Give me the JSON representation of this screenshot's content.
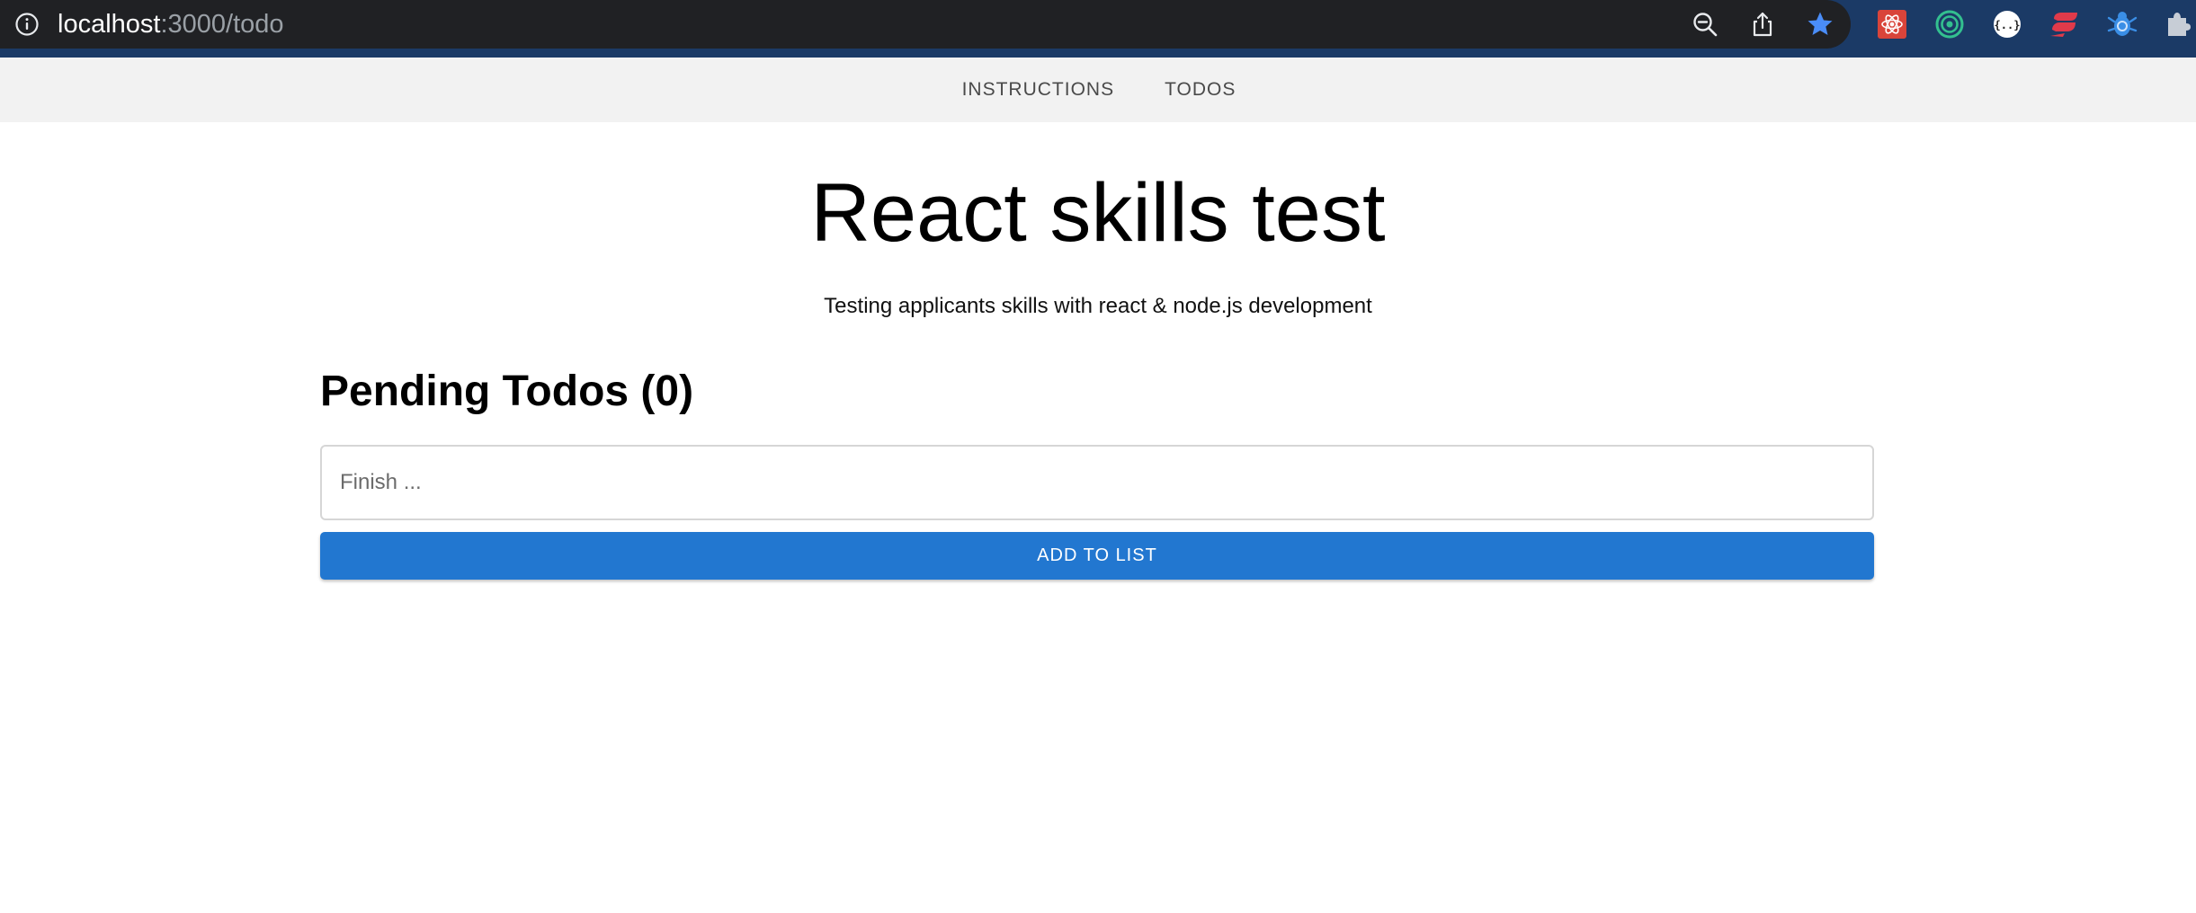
{
  "browser": {
    "url_host": "localhost",
    "url_path": ":3000/todo",
    "icons": [
      "info-icon",
      "zoom-out-icon",
      "share-icon",
      "bookmark-star-icon",
      "react-devtools-icon",
      "target-extension-icon",
      "json-viewer-icon",
      "stack-extension-icon",
      "bug-extension-icon",
      "extensions-puzzle-icon"
    ],
    "colors": {
      "frame": "#1b3a66",
      "omnibox": "#202124",
      "star": "#4a8df8"
    }
  },
  "nav": {
    "items": [
      {
        "label": "INSTRUCTIONS"
      },
      {
        "label": "TODOS"
      }
    ]
  },
  "header": {
    "title": "React skills test",
    "subtitle": "Testing applicants skills with react & node.js development"
  },
  "todos": {
    "heading": "Pending Todos (0)",
    "input_placeholder": "Finish ...",
    "input_value": "",
    "add_button_label": "ADD TO LIST",
    "accent_color": "#2277d0"
  }
}
